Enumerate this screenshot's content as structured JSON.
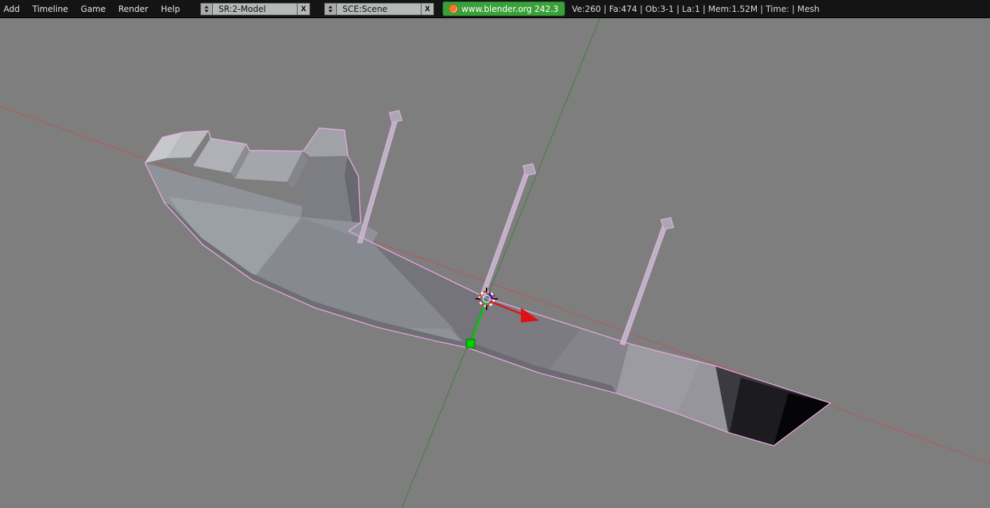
{
  "header": {
    "menus": [
      {
        "label": "Add"
      },
      {
        "label": "Timeline"
      },
      {
        "label": "Game"
      },
      {
        "label": "Render"
      },
      {
        "label": "Help"
      }
    ],
    "screen_selector": {
      "value": "SR:2-Model",
      "close_label": "X"
    },
    "scene_selector": {
      "value": "SCE:Scene",
      "close_label": "X"
    },
    "version_button": {
      "label": "www.blender.org 242.3"
    },
    "stats": "Ve:260 | Fa:474 | Ob:3-1 | La:1 | Mem:1.52M | Time: | Mesh"
  },
  "viewport": {
    "background_color": "#7e7e7e",
    "selected_outline_color": "#e7a9e1",
    "x_axis_color": "#b35a5a",
    "y_axis_color": "#4d7c47",
    "manipulator": {
      "x_arrow_color": "#de1212",
      "y_handle_color": "#00c800",
      "z_dot_color": "#2a2ace"
    }
  }
}
